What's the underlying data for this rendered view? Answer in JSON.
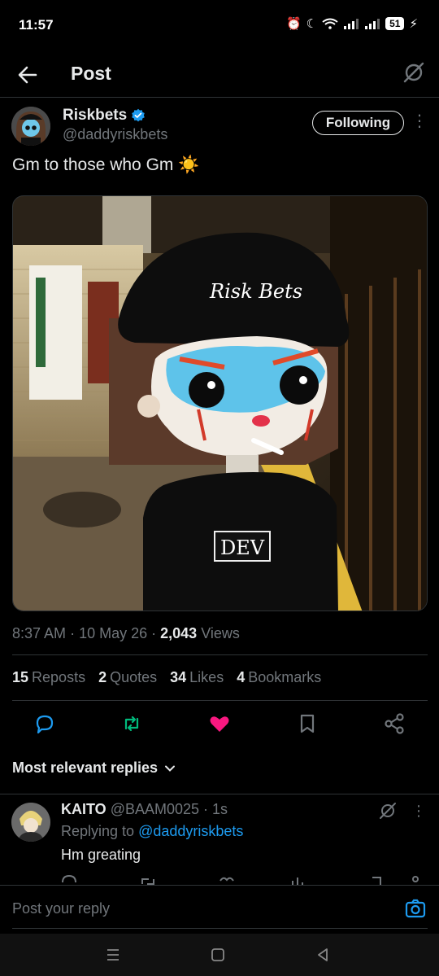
{
  "status": {
    "time": "11:57",
    "battery": "51"
  },
  "topbar": {
    "title": "Post"
  },
  "author": {
    "name": "Riskbets",
    "handle": "@daddyriskbets",
    "follow_label": "Following",
    "more": "⋮"
  },
  "tweet": {
    "text": "Gm to those who Gm",
    "emoji": "☀️"
  },
  "media": {
    "cap_text": "Risk Bets",
    "shirt_text": "DEV"
  },
  "meta": {
    "time": "8:37 AM",
    "date": "10 May 26",
    "views_count": "2,043",
    "views_label": "Views"
  },
  "stats": [
    {
      "count": "15",
      "label": "Reposts"
    },
    {
      "count": "2",
      "label": "Quotes"
    },
    {
      "count": "34",
      "label": "Likes"
    },
    {
      "count": "4",
      "label": "Bookmarks"
    }
  ],
  "sort": {
    "label": "Most relevant replies"
  },
  "reply": {
    "name": "KAITO",
    "handle": "@BAAM0025",
    "time": "· 1s",
    "replying_prefix": "Replying to",
    "replying_to": "@daddyriskbets",
    "text": "Hm greating",
    "more": "⋮"
  },
  "composer": {
    "placeholder": "Post your reply"
  },
  "colors": {
    "accent": "#1d9bf0",
    "like": "#f91880",
    "repost": "#00ba7c",
    "background": "#000000",
    "muted": "#71767b"
  }
}
